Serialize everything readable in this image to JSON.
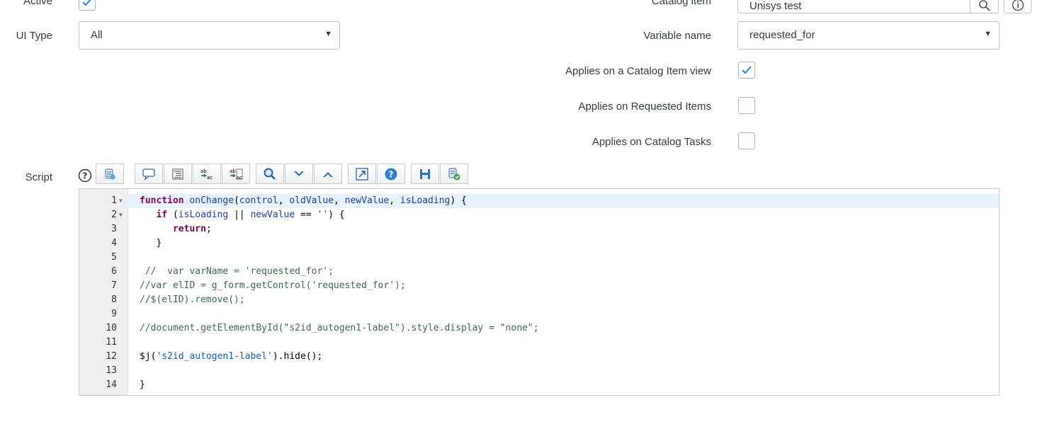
{
  "form": {
    "active_label": "Active",
    "active_checked": true,
    "catalog_item_label": "Catalog item",
    "catalog_item_value": "Unisys test",
    "ui_type_label": "UI Type",
    "ui_type_value": "All",
    "variable_name_label": "Variable name",
    "variable_name_value": "requested_for",
    "applies_catalog_item_view_label": "Applies on a Catalog Item view",
    "applies_catalog_item_view_checked": true,
    "applies_requested_items_label": "Applies on Requested Items",
    "applies_requested_items_checked": false,
    "applies_catalog_tasks_label": "Applies on Catalog Tasks",
    "applies_catalog_tasks_checked": false,
    "script_label": "Script",
    "help_icon": "question-circle-icon"
  },
  "toolbar": {
    "buttons": [
      "toggle-syntax-editor-icon",
      "comment-icon",
      "format-code-icon",
      "replace-icon",
      "replace-all-icon",
      "search-icon",
      "find-next-icon",
      "find-previous-icon",
      "fullscreen-icon",
      "help-icon",
      "save-icon",
      "script-debugger-icon"
    ]
  },
  "editor": {
    "highlighted_line": 1,
    "lines": [
      {
        "num": "1",
        "text": "function onChange(control, oldValue, newValue, isLoading) {"
      },
      {
        "num": "2",
        "text": "   if (isLoading || newValue == '') {"
      },
      {
        "num": "3",
        "text": "      return;"
      },
      {
        "num": "4",
        "text": "   }"
      },
      {
        "num": "5",
        "text": ""
      },
      {
        "num": "6",
        "text": " //  var varName = 'requested_for';"
      },
      {
        "num": "7",
        "text": "//var elID = g_form.getControl('requested_for');"
      },
      {
        "num": "8",
        "text": "//$(elID).remove();"
      },
      {
        "num": "9",
        "text": ""
      },
      {
        "num": "10",
        "text": "//document.getElementById(\"s2id_autogen1-label\").style.display = \"none\";"
      },
      {
        "num": "11",
        "text": ""
      },
      {
        "num": "12",
        "text": "$j('s2id_autogen1-label').hide();"
      },
      {
        "num": "13",
        "text": ""
      },
      {
        "num": "14",
        "text": "}"
      }
    ]
  },
  "colors": {
    "accent": "#2d86e0",
    "line_highlight": "#e8f2fe",
    "keyword": "#7a0b52",
    "comment": "#3f6b4f"
  }
}
